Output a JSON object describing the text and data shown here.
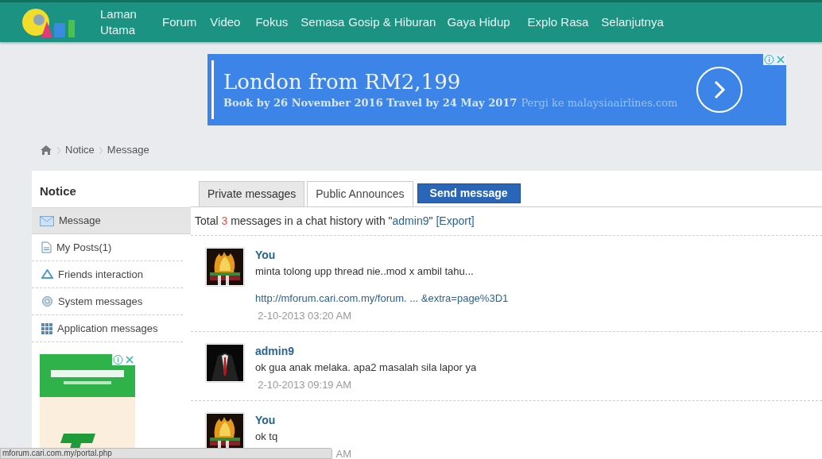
{
  "nav": {
    "items": [
      {
        "label": "Laman Utama"
      },
      {
        "label": "Forum"
      },
      {
        "label": "Video"
      },
      {
        "label": "Fokus"
      },
      {
        "label": "Semasa"
      },
      {
        "label": "Gosip & Hiburan"
      },
      {
        "label": "Gaya Hidup"
      },
      {
        "label": "Explo Rasa"
      },
      {
        "label": "Selanjutnya"
      }
    ]
  },
  "banner_ad": {
    "headline": "London from RM2,199",
    "details": "Book by 26 November 2016 Travel by 24 May 2017",
    "link": "Pergi ke malaysiaairlines.com"
  },
  "breadcrumb": [
    {
      "label": "Notice"
    },
    {
      "label": "Message"
    }
  ],
  "sidebar": {
    "title": "Notice",
    "items": [
      {
        "label": "Message",
        "selected": true
      },
      {
        "label": "My Posts(1)",
        "selected": false
      },
      {
        "label": "Friends interaction",
        "selected": false
      },
      {
        "label": "System messages",
        "selected": false
      },
      {
        "label": "Application messages",
        "selected": false
      }
    ]
  },
  "tabs": [
    {
      "label": "Private messages",
      "selected": true
    },
    {
      "label": "Public Announces",
      "selected": false
    }
  ],
  "send_button": "Send message",
  "summary": {
    "before": "Total",
    "count": "3",
    "middle": "messages in a chat history with \"",
    "user": "admin9",
    "after": "\"",
    "export": "[Export]"
  },
  "messages": [
    {
      "author": "You",
      "text": "minta tolong upp thread nie..mod x ambil tahu...",
      "link": "http://mforum.cari.com.my/forum. ... &extra=page%3D1",
      "time": "2-10-2013 03:20 AM"
    },
    {
      "author": "admin9",
      "text": "ok gua anak melaka. apa2 masalah sila lapor ya",
      "time": "2-10-2013 09:19 AM"
    },
    {
      "author": "You",
      "text": "ok tq",
      "time": "AM"
    }
  ],
  "status_url": "mforum.cari.com.my/portal.php"
}
